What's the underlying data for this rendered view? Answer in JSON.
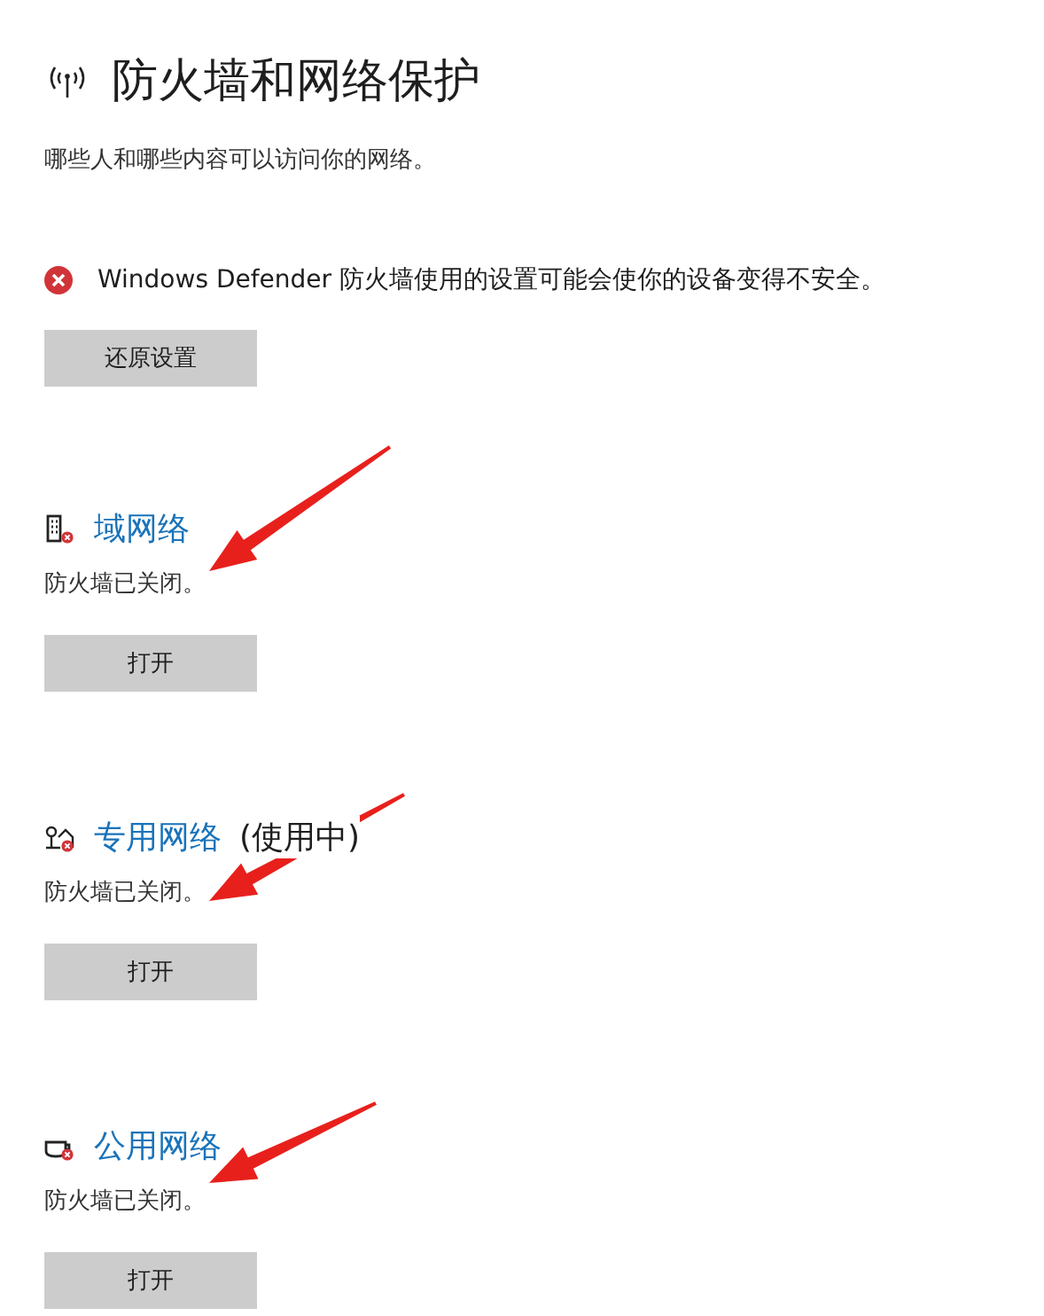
{
  "header": {
    "title": "防火墙和网络保护",
    "subtitle": "哪些人和哪些内容可以访问你的网络。"
  },
  "warning": {
    "text": "Windows Defender 防火墙使用的设置可能会使你的设备变得不安全。",
    "button": "还原设置"
  },
  "networks": [
    {
      "kind": "domain",
      "name": "域网络",
      "firewall_on": false,
      "status": "防火墙已关闭。",
      "button": "打开"
    },
    {
      "kind": "private",
      "name": "专用网络",
      "note": "(使用中)",
      "firewall_on": false,
      "status": "防火墙已关闭。",
      "button": "打开"
    },
    {
      "kind": "public",
      "name": "公用网络",
      "firewall_on": false,
      "status": "防火墙已关闭。",
      "button": "打开"
    }
  ]
}
